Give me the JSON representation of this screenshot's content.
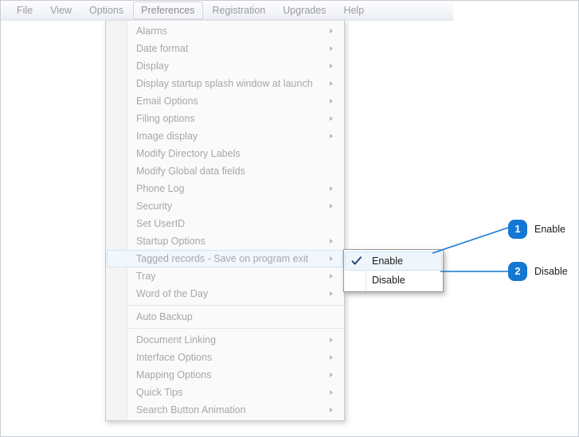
{
  "window": {
    "background_color": "#ffffff",
    "border_color": "#c8ccd2"
  },
  "menubar": {
    "name": "application-menu-bar",
    "items": [
      {
        "label": "File",
        "active": false
      },
      {
        "label": "View",
        "active": false
      },
      {
        "label": "Options",
        "active": false
      },
      {
        "label": "Preferences",
        "active": true
      },
      {
        "label": "Registration",
        "active": false
      },
      {
        "label": "Upgrades",
        "active": false
      },
      {
        "label": "Help",
        "active": false
      }
    ]
  },
  "preferences_menu": {
    "name": "preferences-dropdown-menu",
    "items": [
      {
        "label": "Alarms",
        "submenu": true,
        "separator_before": false,
        "selected": false
      },
      {
        "label": "Date format",
        "submenu": true,
        "separator_before": false,
        "selected": false
      },
      {
        "label": "Display",
        "submenu": true,
        "separator_before": false,
        "selected": false
      },
      {
        "label": "Display startup splash window at launch",
        "submenu": true,
        "separator_before": false,
        "selected": false
      },
      {
        "label": "Email Options",
        "submenu": true,
        "separator_before": false,
        "selected": false
      },
      {
        "label": "Filing options",
        "submenu": true,
        "separator_before": false,
        "selected": false
      },
      {
        "label": "Image display",
        "submenu": true,
        "separator_before": false,
        "selected": false
      },
      {
        "label": "Modify Directory Labels",
        "submenu": false,
        "separator_before": false,
        "selected": false
      },
      {
        "label": "Modify Global data fields",
        "submenu": false,
        "separator_before": false,
        "selected": false
      },
      {
        "label": "Phone Log",
        "submenu": true,
        "separator_before": false,
        "selected": false
      },
      {
        "label": "Security",
        "submenu": true,
        "separator_before": false,
        "selected": false
      },
      {
        "label": "Set UserID",
        "submenu": false,
        "separator_before": false,
        "selected": false
      },
      {
        "label": "Startup Options",
        "submenu": true,
        "separator_before": false,
        "selected": false
      },
      {
        "label": "Tagged records - Save on program exit",
        "submenu": true,
        "separator_before": false,
        "selected": true
      },
      {
        "label": "Tray",
        "submenu": true,
        "separator_before": false,
        "selected": false
      },
      {
        "label": "Word of the Day",
        "submenu": true,
        "separator_before": false,
        "selected": false
      },
      {
        "label": "Auto Backup",
        "submenu": false,
        "separator_before": true,
        "selected": false
      },
      {
        "label": "Document Linking",
        "submenu": true,
        "separator_before": true,
        "selected": false
      },
      {
        "label": "Interface Options",
        "submenu": true,
        "separator_before": false,
        "selected": false
      },
      {
        "label": "Mapping Options",
        "submenu": true,
        "separator_before": false,
        "selected": false
      },
      {
        "label": "Quick Tips",
        "submenu": true,
        "separator_before": false,
        "selected": false
      },
      {
        "label": "Search Button Animation",
        "submenu": true,
        "separator_before": false,
        "selected": false
      }
    ]
  },
  "tagged_records_submenu": {
    "name": "tagged-records-submenu",
    "items": [
      {
        "label": "Enable",
        "checked": true,
        "selected": true
      },
      {
        "label": "Disable",
        "checked": false,
        "selected": false
      }
    ]
  },
  "callouts": {
    "accent_color": "#1477d4",
    "items": [
      {
        "number": "1",
        "label": "Enable"
      },
      {
        "number": "2",
        "label": "Disable"
      }
    ]
  }
}
